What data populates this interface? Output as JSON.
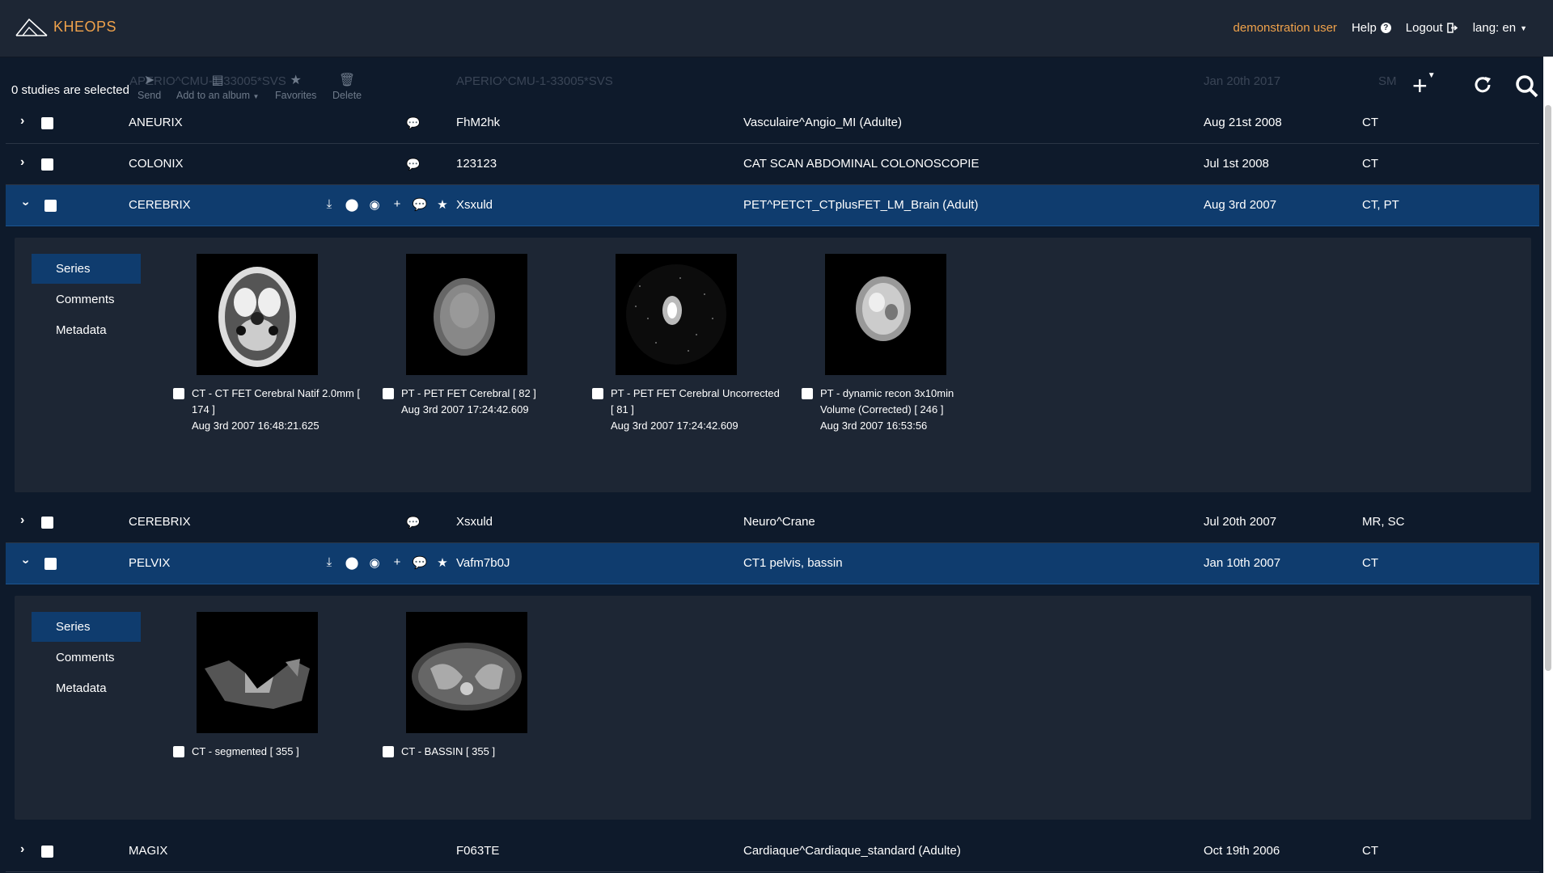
{
  "app": {
    "logo_text": "KHEOPS"
  },
  "nav": {
    "user": "demonstration user",
    "help": "Help",
    "logout": "Logout",
    "lang": "lang: en"
  },
  "ghost_row": {
    "name": "APERIO^CMU-1-33005*SVS",
    "pid": "APERIO^CMU-1-33005*SVS",
    "date": "Jan 20th 2017",
    "mod": "SM"
  },
  "toolbar": {
    "selected": "0 studies are selected",
    "send": "Send",
    "album": "Add to an album",
    "favorites": "Favorites",
    "delete": "Delete"
  },
  "studies": [
    {
      "name": "ANEURIX",
      "pid": "FhM2hk",
      "desc": "Vasculaire^Angio_MI (Adulte)",
      "date": "Aug 21st 2008",
      "mod": "CT"
    },
    {
      "name": "COLONIX",
      "pid": "123123",
      "desc": "CAT SCAN ABDOMINAL COLONOSCOPIE",
      "date": "Jul 1st 2008",
      "mod": "CT"
    },
    {
      "name": "CEREBRIX",
      "pid": "Xsxuld",
      "desc": "PET^PETCT_CTplusFET_LM_Brain (Adult)",
      "date": "Aug 3rd 2007",
      "mod": "CT, PT"
    },
    {
      "name": "CEREBRIX",
      "pid": "Xsxuld",
      "desc": "Neuro^Crane",
      "date": "Jul 20th 2007",
      "mod": "MR, SC"
    },
    {
      "name": "PELVIX",
      "pid": "Vafm7b0J",
      "desc": "CT1 pelvis, bassin",
      "date": "Jan 10th 2007",
      "mod": "CT"
    },
    {
      "name": "MAGIX",
      "pid": "F063TE",
      "desc": "Cardiaque^Cardiaque_standard (Adulte)",
      "date": "Oct 19th 2006",
      "mod": "CT"
    }
  ],
  "panel_tabs": {
    "series": "Series",
    "comments": "Comments",
    "metadata": "Metadata"
  },
  "cerebrix_series": [
    {
      "l1": "CT - CT FET Cerebral Natif 2.0mm [",
      "l2": "174 ]",
      "l3": "Aug 3rd 2007 16:48:21.625"
    },
    {
      "l1": "PT - PET FET Cerebral [ 82 ]",
      "l2": "Aug 3rd 2007 17:24:42.609",
      "l3": ""
    },
    {
      "l1": "PT - PET FET Cerebral Uncorrected",
      "l2": "[ 81 ]",
      "l3": "Aug 3rd 2007 17:24:42.609"
    },
    {
      "l1": "PT - dynamic recon 3x10min",
      "l2": "Volume (Corrected) [ 246 ]",
      "l3": "Aug 3rd 2007 16:53:56"
    }
  ],
  "pelvix_series": [
    {
      "l1": "CT - segmented [ 355 ]"
    },
    {
      "l1": "CT - BASSIN [ 355 ]"
    }
  ]
}
